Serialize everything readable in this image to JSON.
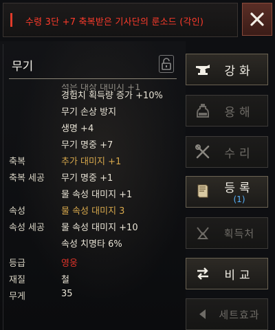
{
  "title": "수령 3단 +7 축복받은 기사단의 룬소드 (각인)",
  "colors": {
    "title": "#ff3b2b",
    "gold": "#d7a84c",
    "grade_red": "#e0342a",
    "sub_blue": "#58b4ff"
  },
  "panel": {
    "category": "무기",
    "partial_line": "적은 대상 대미지 +1",
    "rows": [
      {
        "label": "",
        "value": "경험치 획득량 증가 +10%",
        "color": "normal"
      },
      {
        "label": "",
        "value": "무기 손상 방지",
        "color": "normal"
      },
      {
        "label": "",
        "value": "생명 +4",
        "color": "normal"
      },
      {
        "label": "",
        "value": "무기 명중 +7",
        "color": "normal"
      },
      {
        "label": "축복",
        "value": "추가 대미지 +1",
        "color": "gold"
      },
      {
        "label": "축복 세공",
        "value": "무기 명중 +1",
        "color": "normal"
      },
      {
        "label": "",
        "value": "물 속성 대미지 +1",
        "color": "normal"
      },
      {
        "label": "속성",
        "value": "물 속성 대미지  3",
        "color": "gold"
      },
      {
        "label": "속성 세공",
        "value": "물 속성 대미지 +10",
        "color": "normal"
      },
      {
        "label": "",
        "value": "속성 치명타 6%",
        "color": "normal"
      },
      {
        "label": "등급",
        "value": "영웅",
        "color": "red"
      },
      {
        "label": "재질",
        "value": "철",
        "color": "normal"
      },
      {
        "label": "무게",
        "value": "35",
        "color": "normal"
      }
    ]
  },
  "actions": {
    "enhance": "강화",
    "dismantle": "용해",
    "repair": "수리",
    "register": "등록",
    "register_count": "(1)",
    "acquire": "획득처",
    "compare": "비교",
    "set_effect": "세트효과"
  },
  "icons": {
    "close": "close-icon",
    "lock": "unlock-icon",
    "enhance": "anvil-icon",
    "dismantle": "potion-icon",
    "repair": "tools-icon",
    "register": "book-icon",
    "acquire": "source-icon",
    "compare": "swap-arrows-icon",
    "set_effect": "arrow-left-icon"
  }
}
